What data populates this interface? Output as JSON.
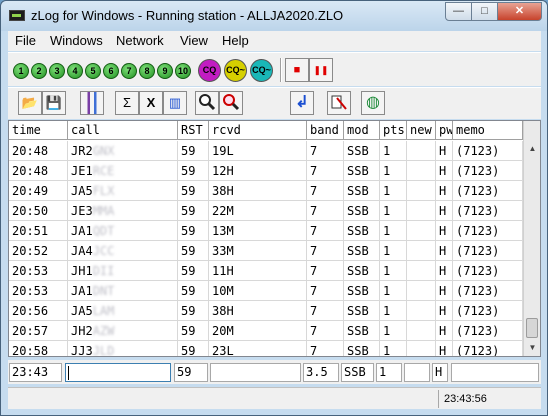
{
  "window": {
    "title": "zLog for Windows - Running station - ALLJA2020.ZLO",
    "min_icon": "—",
    "max_icon": "□",
    "close_icon": "✕"
  },
  "menu": [
    "File",
    "Windows",
    "Network",
    "View",
    "Help"
  ],
  "toolbar1": {
    "bands": [
      "1",
      "2",
      "3",
      "4",
      "5",
      "6",
      "7",
      "8",
      "9",
      "10"
    ],
    "cq": [
      {
        "label": "CQ",
        "color": "#c21cc2"
      },
      {
        "label": "CQ~",
        "color": "#d6d000"
      },
      {
        "label": "CQ~",
        "color": "#1ab7b7"
      }
    ],
    "stop_icon": "■",
    "pause_icon": "❚❚"
  },
  "toolbar2": {
    "open_icon": "📂",
    "save_icon": "💾",
    "sigma_icon": "Σ",
    "x_icon": "X",
    "chart_icon": "▥",
    "enter_icon": "↲",
    "globe_icon": "◍"
  },
  "columns": [
    "time",
    "call",
    "RST",
    "rcvd",
    "band",
    "mod",
    "pts",
    "new",
    "pw",
    "memo"
  ],
  "rows": [
    {
      "time": "20:48",
      "call_prefix": "JR2",
      "call_blur": "GNX",
      "rst": "59",
      "rcvd": "19L",
      "band": "7",
      "mod": "SSB",
      "pts": "1",
      "new": "",
      "pw": "H",
      "memo": "(7123)"
    },
    {
      "time": "20:48",
      "call_prefix": "JE1",
      "call_blur": "RCE",
      "rst": "59",
      "rcvd": "12H",
      "band": "7",
      "mod": "SSB",
      "pts": "1",
      "new": "",
      "pw": "H",
      "memo": "(7123)"
    },
    {
      "time": "20:49",
      "call_prefix": "JA5",
      "call_blur": "FLX",
      "rst": "59",
      "rcvd": "38H",
      "band": "7",
      "mod": "SSB",
      "pts": "1",
      "new": "",
      "pw": "H",
      "memo": "(7123)"
    },
    {
      "time": "20:50",
      "call_prefix": "JE3",
      "call_blur": "MMA",
      "rst": "59",
      "rcvd": "22M",
      "band": "7",
      "mod": "SSB",
      "pts": "1",
      "new": "",
      "pw": "H",
      "memo": "(7123)"
    },
    {
      "time": "20:51",
      "call_prefix": "JA1",
      "call_blur": "QDT",
      "rst": "59",
      "rcvd": "13M",
      "band": "7",
      "mod": "SSB",
      "pts": "1",
      "new": "",
      "pw": "H",
      "memo": "(7123)"
    },
    {
      "time": "20:52",
      "call_prefix": "JA4",
      "call_blur": "JCC",
      "rst": "59",
      "rcvd": "33M",
      "band": "7",
      "mod": "SSB",
      "pts": "1",
      "new": "",
      "pw": "H",
      "memo": "(7123)"
    },
    {
      "time": "20:53",
      "call_prefix": "JH1",
      "call_blur": "DII",
      "rst": "59",
      "rcvd": "11H",
      "band": "7",
      "mod": "SSB",
      "pts": "1",
      "new": "",
      "pw": "H",
      "memo": "(7123)"
    },
    {
      "time": "20:53",
      "call_prefix": "JA1",
      "call_blur": "DNT",
      "rst": "59",
      "rcvd": "10M",
      "band": "7",
      "mod": "SSB",
      "pts": "1",
      "new": "",
      "pw": "H",
      "memo": "(7123)"
    },
    {
      "time": "20:56",
      "call_prefix": "JA5",
      "call_blur": "LAM",
      "rst": "59",
      "rcvd": "38H",
      "band": "7",
      "mod": "SSB",
      "pts": "1",
      "new": "",
      "pw": "H",
      "memo": "(7123)"
    },
    {
      "time": "20:57",
      "call_prefix": "JH2",
      "call_blur": "AZW",
      "rst": "59",
      "rcvd": "20M",
      "band": "7",
      "mod": "SSB",
      "pts": "1",
      "new": "",
      "pw": "H",
      "memo": "(7123)"
    },
    {
      "time": "20:58",
      "call_prefix": "JJ3",
      "call_blur": "JLD",
      "rst": "59",
      "rcvd": "23L",
      "band": "7",
      "mod": "SSB",
      "pts": "1",
      "new": "",
      "pw": "H",
      "memo": "(7123)"
    }
  ],
  "entry": {
    "time": "23:43",
    "call": "",
    "rst": "59",
    "rcvd": "",
    "band": "3.5",
    "mode": "SSB",
    "pts": "1",
    "new": "",
    "power": "H",
    "memo": ""
  },
  "status": {
    "clock": "23:43:56"
  }
}
